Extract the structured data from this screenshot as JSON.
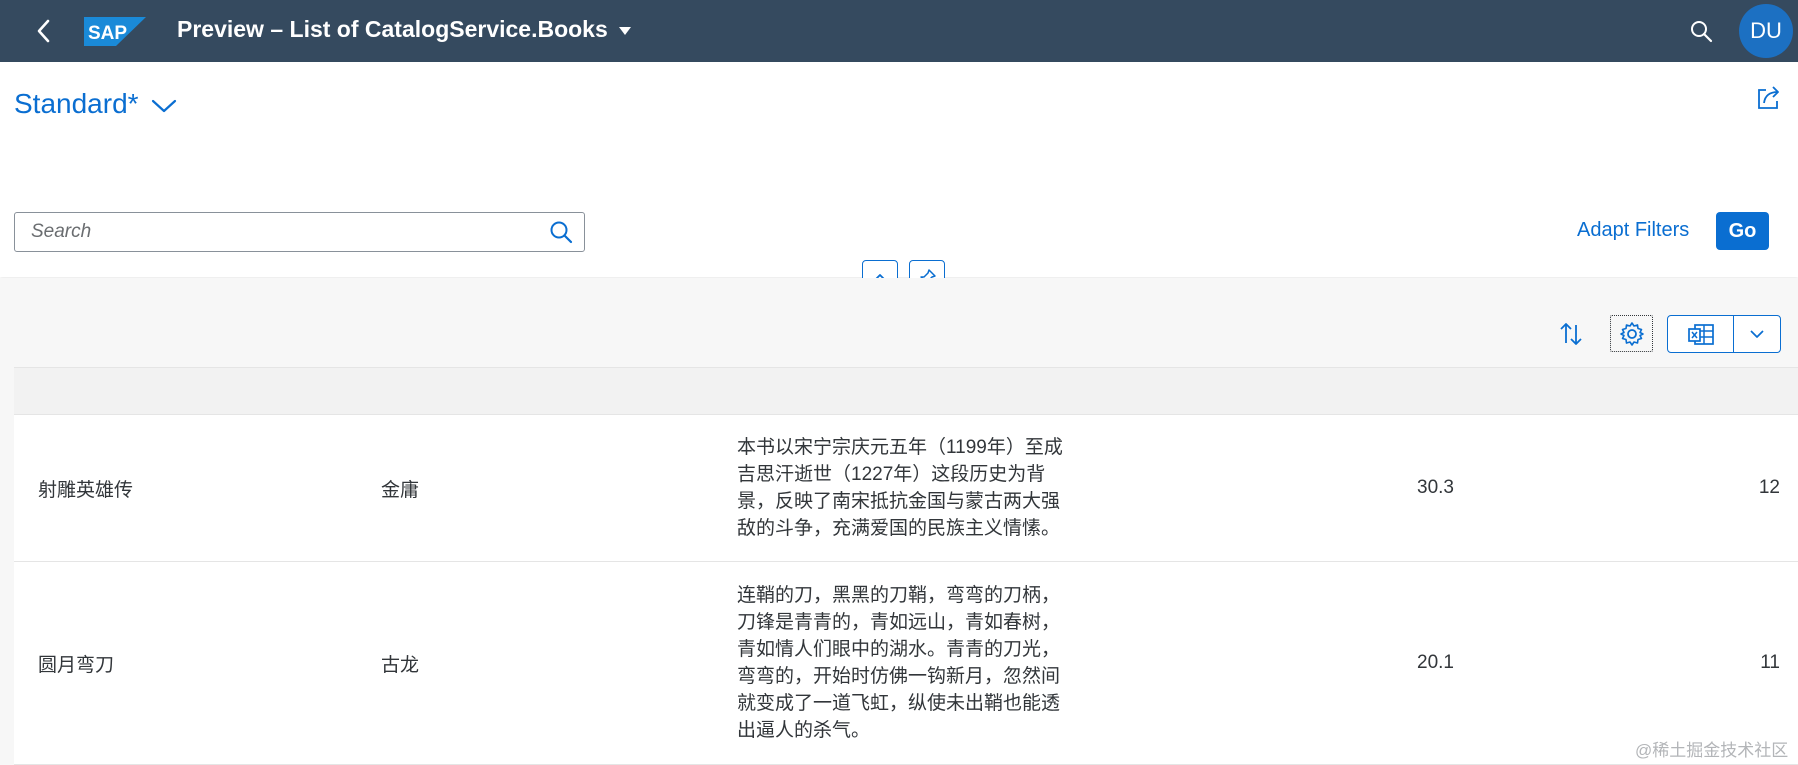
{
  "shell": {
    "logo_text": "SAP",
    "title": "Preview – List of CatalogService.Books",
    "avatar_initials": "DU"
  },
  "header": {
    "variant_name": "Standard*"
  },
  "filterbar": {
    "search_placeholder": "Search",
    "adapt_filters_label": "Adapt Filters",
    "go_label": "Go"
  },
  "table": {
    "rows": [
      {
        "title": "射雕英雄传",
        "author": "金庸",
        "description": "本书以宋宁宗庆元五年（1199年）至成吉思汗逝世（1227年）这段历史为背景，反映了南宋抵抗金国与蒙古两大强敌的斗争，充满爱国的民族主义情愫。",
        "price": "30.3",
        "stock": "12"
      },
      {
        "title": "圆月弯刀",
        "author": "古龙",
        "description": "连鞘的刀，黑黑的刀鞘，弯弯的刀柄，刀锋是青青的，青如远山，青如春树，青如情人们眼中的湖水。青青的刀光，弯弯的，开始时仿佛一钩新月，忽然间就变成了一道飞虹，纵使未出鞘也能透出逼人的杀气。",
        "price": "20.1",
        "stock": "11"
      }
    ]
  },
  "watermark": "@稀土掘金技术社区",
  "colors": {
    "shell_bg": "#354a5f",
    "accent": "#0a6ed1",
    "avatar_bg": "#1c70c2",
    "content_bg": "#f7f7f7"
  }
}
